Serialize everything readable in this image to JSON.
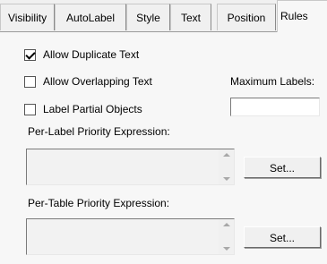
{
  "tabs": [
    {
      "label": "Visibility"
    },
    {
      "label": "AutoLabel"
    },
    {
      "label": "Style"
    },
    {
      "label": "Text"
    },
    {
      "label": "Position"
    },
    {
      "label": "Rules"
    }
  ],
  "active_tab": "Rules",
  "checkboxes": {
    "allow_duplicate": {
      "label": "Allow Duplicate Text",
      "checked": true
    },
    "allow_overlapping": {
      "label": "Allow Overlapping Text",
      "checked": false
    },
    "label_partial": {
      "label": "Label Partial Objects",
      "checked": false
    }
  },
  "max_labels": {
    "label": "Maximum Labels:",
    "value": ""
  },
  "per_label": {
    "label": "Per-Label Priority Expression:",
    "value": "",
    "button": "Set..."
  },
  "per_table": {
    "label": "Per-Table Priority Expression:",
    "value": "",
    "button": "Set..."
  }
}
